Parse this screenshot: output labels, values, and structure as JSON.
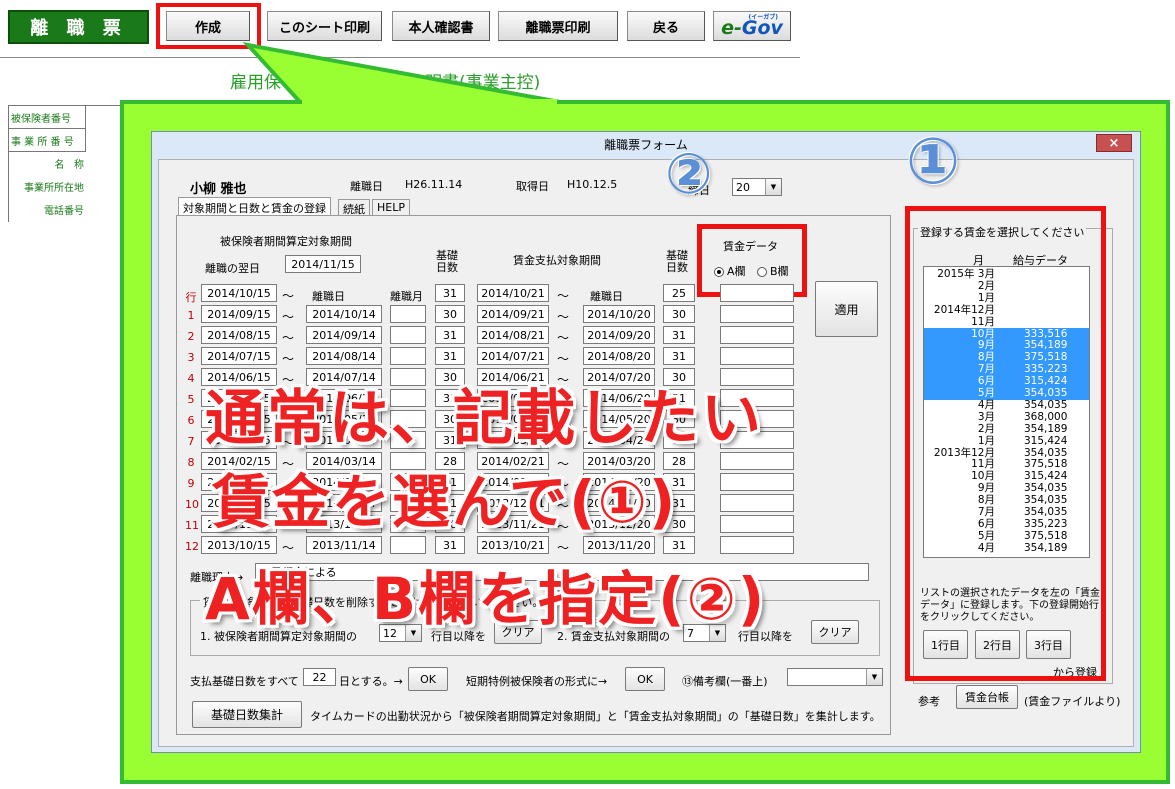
{
  "toolbar": {
    "title": "離 職 票",
    "create": "作成",
    "print_sheet": "このシート印刷",
    "id_doc": "本人確認書",
    "print_rizoku": "離職票印刷",
    "back": "戻る",
    "egov_prefix": "e-",
    "egov_word": "Gov",
    "egov_ruby": "(イーガブ)"
  },
  "sheet": {
    "subtitle": "雇用保",
    "subtitle_tail": "明書(事業主控)",
    "labels": [
      "被保険者番号",
      "事 業 所 番 号",
      "名   称",
      "事業所所在地",
      "電話番号"
    ]
  },
  "form": {
    "title": "離職票フォーム",
    "close": "×",
    "name": "小柳 雅也",
    "retire_label": "離職日",
    "retire_value": "H26.11.14",
    "acquire_label": "取得日",
    "acquire_value": "H10.12.5",
    "day_label": "締日",
    "day_value": "20",
    "tabs": [
      "対象期間と日数と賃金の登録",
      "続紙",
      "HELP"
    ],
    "period_header": "被保険者期間算定対象期間",
    "next_day_label": "離職の翌日",
    "next_day_value": "2014/11/15",
    "base_days_header": "基礎日数",
    "wage_period_header": "賃金支払対象期間",
    "base_days_header2": "基礎日数",
    "wage_data_label": "賃金データ",
    "col_a": "A欄",
    "col_b": "B欄",
    "apply": "適用",
    "row_header": {
      "label": "行",
      "from": "2014/10/15",
      "to": "離職日",
      "month": "離職月",
      "days": "31",
      "wfrom": "2014/10/21",
      "wto": "離職日",
      "wdays": "25"
    },
    "rows": [
      {
        "n": "1",
        "from": "2014/09/15",
        "to": "2014/10/14",
        "days": "30",
        "wfrom": "2014/09/21",
        "wto": "2014/10/20",
        "wdays": "30"
      },
      {
        "n": "2",
        "from": "2014/08/15",
        "to": "2014/09/14",
        "days": "31",
        "wfrom": "2014/08/21",
        "wto": "2014/09/20",
        "wdays": "31"
      },
      {
        "n": "3",
        "from": "2014/07/15",
        "to": "2014/08/14",
        "days": "31",
        "wfrom": "2014/07/21",
        "wto": "2014/08/20",
        "wdays": "31"
      },
      {
        "n": "4",
        "from": "2014/06/15",
        "to": "2014/07/14",
        "days": "30",
        "wfrom": "2014/06/21",
        "wto": "2014/07/20",
        "wdays": "30"
      },
      {
        "n": "5",
        "from": "2014/05/15",
        "to": "2014/06/14",
        "days": "31",
        "wfrom": "2014/05/21",
        "wto": "2014/06/20",
        "wdays": "31"
      },
      {
        "n": "6",
        "from": "2014/04/15",
        "to": "2014/05/14",
        "days": "30",
        "wfrom": "2014/04/21",
        "wto": "2014/05/20",
        "wdays": "30"
      },
      {
        "n": "7",
        "from": "2014/03/15",
        "to": "2014/04/14",
        "days": "31",
        "wfrom": "2014/03/21",
        "wto": "2014/04/20",
        "wdays": "31"
      },
      {
        "n": "8",
        "from": "2014/02/15",
        "to": "2014/03/14",
        "days": "28",
        "wfrom": "2014/02/21",
        "wto": "2014/03/20",
        "wdays": "28"
      },
      {
        "n": "9",
        "from": "2014/01/15",
        "to": "2014/02/14",
        "days": "31",
        "wfrom": "2014/01/21",
        "wto": "2014/02/20",
        "wdays": "31"
      },
      {
        "n": "10",
        "from": "2013/12/15",
        "to": "2014/01/14",
        "days": "31",
        "wfrom": "2013/12/21",
        "wto": "2014/01/20",
        "wdays": "31"
      },
      {
        "n": "11",
        "from": "2013/11/15",
        "to": "2013/12/14",
        "days": "30",
        "wfrom": "2013/11/21",
        "wto": "2013/12/20",
        "wdays": "30"
      },
      {
        "n": "12",
        "from": "2013/10/15",
        "to": "2013/11/14",
        "days": "31",
        "wfrom": "2013/10/21",
        "wto": "2013/11/20",
        "wdays": "31"
      }
    ],
    "reason_label": "離職理由→",
    "reason_value": "自己都合による",
    "group_caption": "賃金の対象期間の基礎日数を削除するときはクリックしてください。",
    "clear1_label": "1. 被保険者期間算定対象期間の",
    "clear1_value": "12",
    "clear1_suffix": "行目以降を",
    "clear": "クリア",
    "clear2_label": "2. 賃金支払対象期間の",
    "clear2_value": "7",
    "clear2_suffix": "行目以降を",
    "all_days_label": "支払基礎日数をすべて",
    "all_days_value": "22",
    "all_days_suffix": "日とする。→",
    "ok": "OK",
    "short_label": "短期特例被保険者の形式に→",
    "remarks_label": "⑬備考欄(一番上)",
    "sum_button": "基礎日数集計",
    "sum_desc": "タイムカードの出勤状況から「被保険者期間算定対象期間」と「賃金支払対象期間」の「基礎日数」を集計します。"
  },
  "wage_panel": {
    "caption": "登録する賃金を選択してください",
    "col_month": "月",
    "col_data": "給与データ",
    "items": [
      {
        "m": "2015年 3月",
        "v": "",
        "sel": false
      },
      {
        "m": "2月",
        "v": "",
        "sel": false
      },
      {
        "m": "1月",
        "v": "",
        "sel": false
      },
      {
        "m": "2014年12月",
        "v": "",
        "sel": false
      },
      {
        "m": "11月",
        "v": "",
        "sel": false
      },
      {
        "m": "10月",
        "v": "333,516",
        "sel": true
      },
      {
        "m": "9月",
        "v": "354,189",
        "sel": true
      },
      {
        "m": "8月",
        "v": "375,518",
        "sel": true
      },
      {
        "m": "7月",
        "v": "335,223",
        "sel": true
      },
      {
        "m": "6月",
        "v": "315,424",
        "sel": true
      },
      {
        "m": "5月",
        "v": "354,035",
        "sel": true
      },
      {
        "m": "4月",
        "v": "354,035",
        "sel": false
      },
      {
        "m": "3月",
        "v": "368,000",
        "sel": false
      },
      {
        "m": "2月",
        "v": "354,189",
        "sel": false
      },
      {
        "m": "1月",
        "v": "315,424",
        "sel": false
      },
      {
        "m": "2013年12月",
        "v": "354,035",
        "sel": false
      },
      {
        "m": "11月",
        "v": "375,518",
        "sel": false
      },
      {
        "m": "10月",
        "v": "315,424",
        "sel": false
      },
      {
        "m": "9月",
        "v": "354,035",
        "sel": false
      },
      {
        "m": "8月",
        "v": "354,035",
        "sel": false
      },
      {
        "m": "7月",
        "v": "354,035",
        "sel": false
      },
      {
        "m": "6月",
        "v": "335,223",
        "sel": false
      },
      {
        "m": "5月",
        "v": "375,518",
        "sel": false
      },
      {
        "m": "4月",
        "v": "354,189",
        "sel": false
      }
    ],
    "note": "リストの選択されたデータを左の「賃金データ」に登録します。下の登録開始行をクリックしてください。",
    "row1": "1行目",
    "row2": "2行目",
    "row3": "3行目",
    "register": "から登録",
    "ref_label": "参考",
    "ledger": "賃金台帳",
    "ledger_note": "(賃金ファイルより)"
  },
  "annotation": {
    "line1": "通常は、記載したい",
    "line2": "賃金を選んで(①)",
    "line3": "A欄、B欄を指定(②)",
    "circle1": "①",
    "circle2": "②"
  },
  "colors": {
    "callout_green": "#99ff33",
    "callout_border": "#33bb33",
    "highlight_red": "#ee1111",
    "form_bg": "#f0f0f0",
    "title_bar": "#dbe8f8",
    "sel_blue": "#3399ff",
    "rowno_red": "#c00000"
  }
}
